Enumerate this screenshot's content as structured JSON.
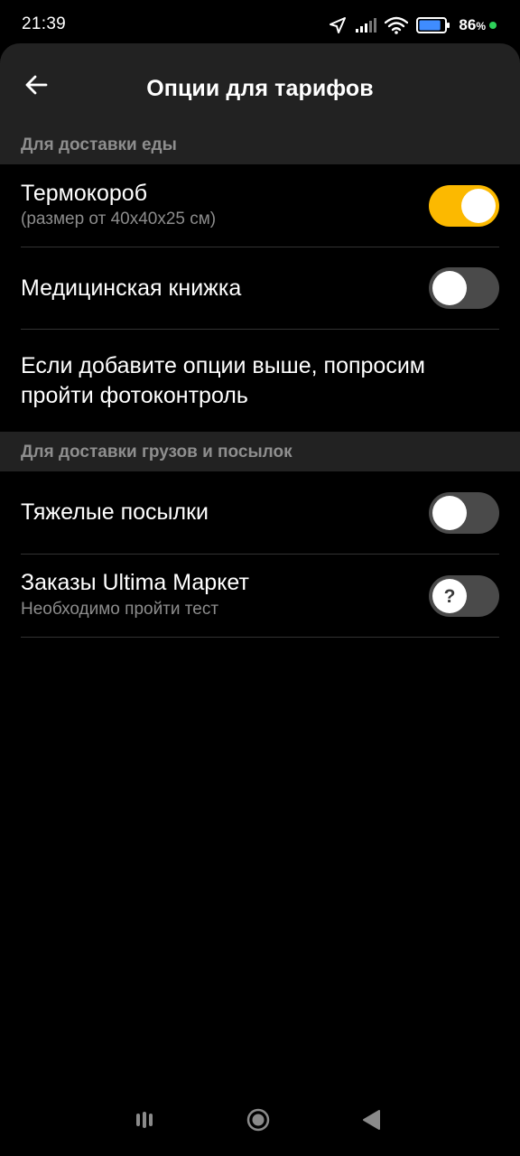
{
  "status_bar": {
    "time": "21:39",
    "battery_percent": "86",
    "battery_sign": "%",
    "battery_level": 0.86,
    "icons": [
      "location-arrow-icon",
      "signal-bars-icon",
      "wifi-icon",
      "battery-icon",
      "charging-dot-icon"
    ]
  },
  "header": {
    "title": "Опции для тарифов",
    "back_icon": "arrow-left-icon"
  },
  "sections": [
    {
      "title": "Для доставки еды",
      "items": [
        {
          "title": "Термокороб",
          "subtitle": "(размер от 40x40x25 см)",
          "toggle_on": true
        },
        {
          "title": "Медицинская книжка",
          "toggle_on": false
        }
      ],
      "note": "Если добавите опции выше, попросим пройти фотоконтроль"
    },
    {
      "title": "Для доставки грузов и посылок",
      "items": [
        {
          "title": "Тяжелые посылки",
          "toggle_on": false
        },
        {
          "title": "Заказы Ultima Маркет",
          "subtitle": "Необходимо пройти тест",
          "toggle_on": false,
          "knob_symbol": "?"
        }
      ]
    }
  ],
  "colors": {
    "accent": "#fcb900",
    "background": "#000000",
    "surface": "#222222",
    "toggle_off": "#4a4a4a",
    "secondary_text": "#8c8c8c"
  },
  "nav_bar": {
    "icons": [
      "recent-apps-icon",
      "home-icon",
      "back-triangle-icon"
    ]
  }
}
